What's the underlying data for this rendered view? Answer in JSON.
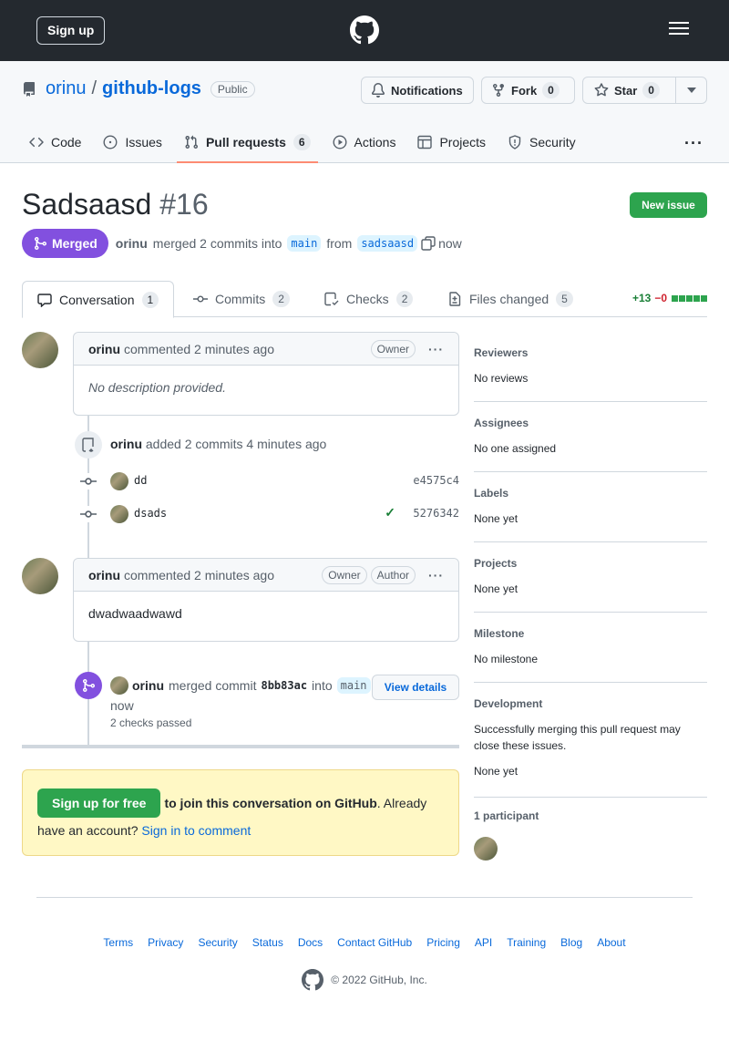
{
  "topbar": {
    "signup": "Sign up"
  },
  "repo": {
    "owner": "orinu",
    "sep": "/",
    "name": "github-logs",
    "visibility": "Public",
    "notifications": "Notifications",
    "fork": "Fork",
    "fork_count": "0",
    "star": "Star",
    "star_count": "0"
  },
  "nav": {
    "tabs": [
      {
        "label": "Code"
      },
      {
        "label": "Issues"
      },
      {
        "label": "Pull requests",
        "count": "6"
      },
      {
        "label": "Actions"
      },
      {
        "label": "Projects"
      },
      {
        "label": "Security"
      }
    ]
  },
  "pr": {
    "title": "Sadsaasd",
    "number": "#16",
    "new_issue": "New issue",
    "state": "Merged",
    "author": "orinu",
    "merge_text": "merged 2 commits into",
    "base": "main",
    "from": "from",
    "head": "sadsaasd",
    "time": "now"
  },
  "prtabs": [
    {
      "label": "Conversation",
      "count": "1"
    },
    {
      "label": "Commits",
      "count": "2"
    },
    {
      "label": "Checks",
      "count": "2"
    },
    {
      "label": "Files changed",
      "count": "5"
    }
  ],
  "diffstat": {
    "add": "+13",
    "del": "−0"
  },
  "comment1": {
    "author": "orinu",
    "meta": "commented 2 minutes ago",
    "role": "Owner",
    "body": "No description provided."
  },
  "commits_event": {
    "author": "orinu",
    "meta": "added 2 commits 4 minutes ago",
    "items": [
      {
        "msg": "dd",
        "sha": "e4575c4",
        "check": ""
      },
      {
        "msg": "dsads",
        "sha": "5276342",
        "check": "✓"
      }
    ]
  },
  "comment2": {
    "author": "orinu",
    "meta": "commented 2 minutes ago",
    "role1": "Owner",
    "role2": "Author",
    "body": "dwadwaadwawd"
  },
  "merge_event": {
    "author": "orinu",
    "text1": "merged commit",
    "sha": "8bb83ac",
    "text2": "into",
    "branch": "main",
    "time": "now",
    "checks": "2 checks passed",
    "button": "View details"
  },
  "signup_box": {
    "button": "Sign up for free",
    "text1": "to join this conversation on GitHub",
    "text2": ". Already have an account?",
    "link": "Sign in to comment"
  },
  "sidebar": {
    "reviewers": {
      "title": "Reviewers",
      "value": "No reviews"
    },
    "assignees": {
      "title": "Assignees",
      "value": "No one assigned"
    },
    "labels": {
      "title": "Labels",
      "value": "None yet"
    },
    "projects": {
      "title": "Projects",
      "value": "None yet"
    },
    "milestone": {
      "title": "Milestone",
      "value": "No milestone"
    },
    "development": {
      "title": "Development",
      "value": "Successfully merging this pull request may close these issues.",
      "value2": "None yet"
    },
    "participants": {
      "title": "1 participant"
    }
  },
  "footer": {
    "links": [
      "Terms",
      "Privacy",
      "Security",
      "Status",
      "Docs",
      "Contact GitHub",
      "Pricing",
      "API",
      "Training",
      "Blog",
      "About"
    ],
    "copyright": "© 2022 GitHub, Inc."
  }
}
